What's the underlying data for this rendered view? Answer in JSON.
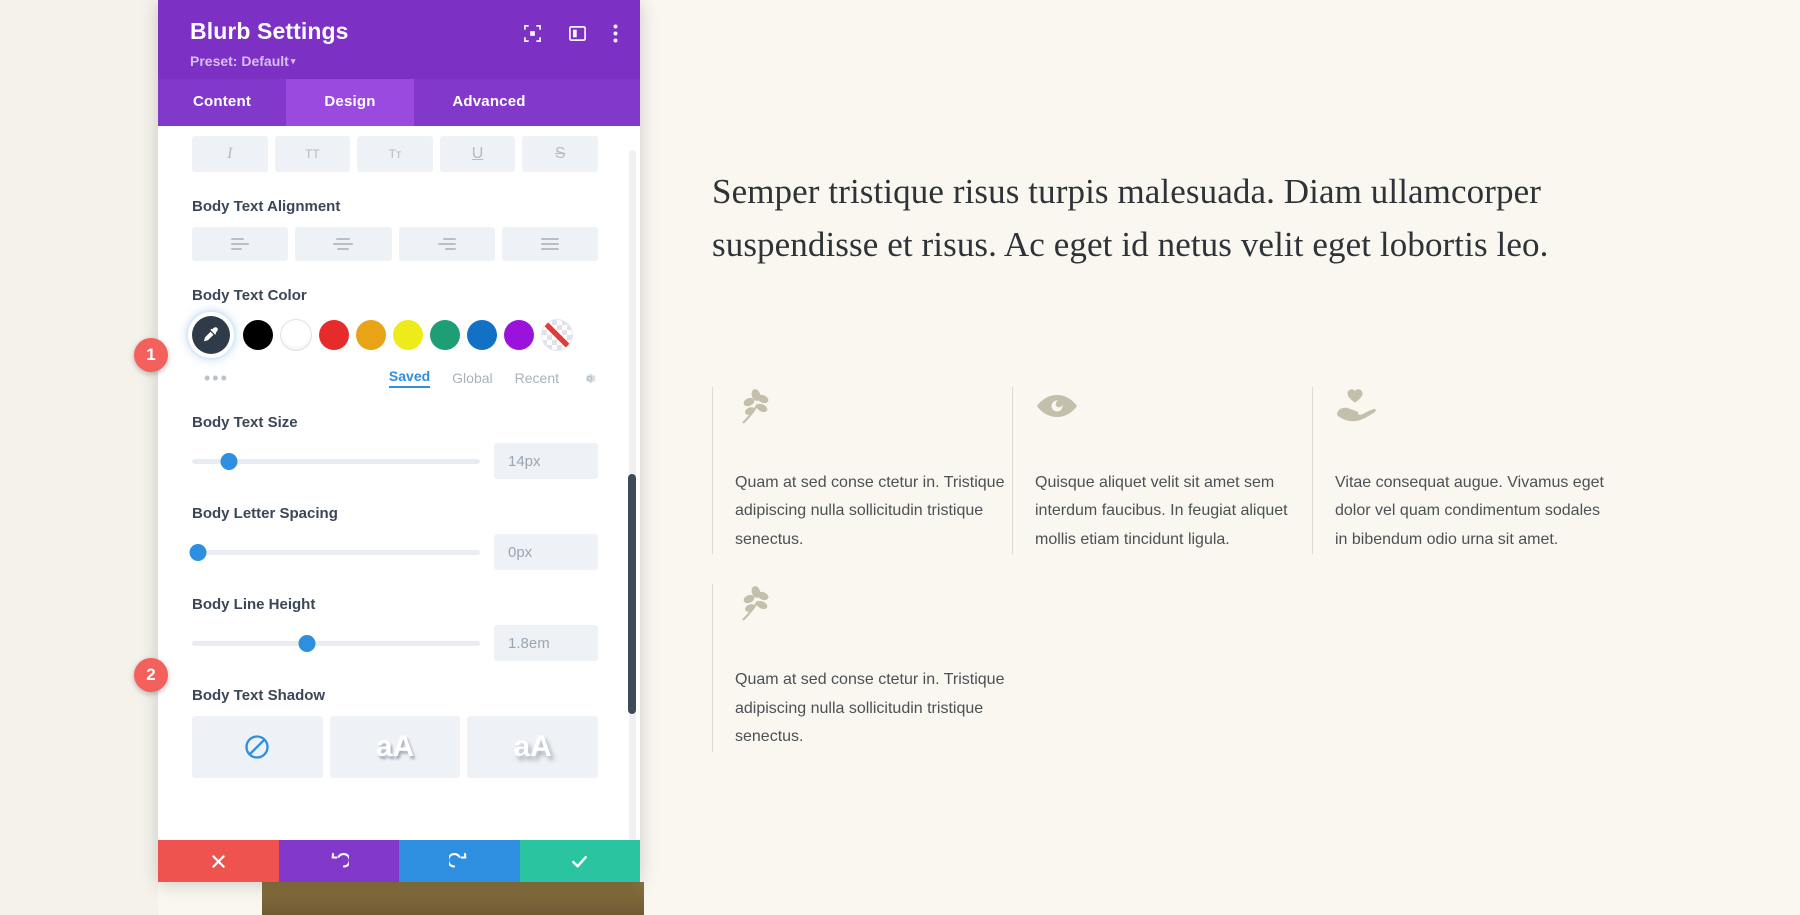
{
  "panel": {
    "title": "Blurb Settings",
    "preset_label": "Preset: Default",
    "header_icons": [
      {
        "name": "focus-icon",
        "label": "focus"
      },
      {
        "name": "layout-panel-icon",
        "label": "layout"
      },
      {
        "name": "more-vertical-icon",
        "label": "more"
      }
    ],
    "tabs": [
      {
        "label": "Content",
        "active": false
      },
      {
        "label": "Design",
        "active": true
      },
      {
        "label": "Advanced",
        "active": false
      }
    ],
    "text_style_buttons": [
      {
        "name": "italic-button",
        "glyph": "I"
      },
      {
        "name": "uppercase-button",
        "glyph": "TT"
      },
      {
        "name": "capitalize-button",
        "glyph": "Tт"
      },
      {
        "name": "underline-button",
        "glyph": "U"
      },
      {
        "name": "strikethrough-button",
        "glyph": "S"
      }
    ],
    "alignment": {
      "label": "Body Text Alignment",
      "options": [
        "align-left",
        "align-center",
        "align-right",
        "align-justify"
      ]
    },
    "color": {
      "label": "Body Text Color",
      "picker_name": "eyedropper-picker",
      "swatches": [
        {
          "name": "swatch-black",
          "hex": "#000000"
        },
        {
          "name": "swatch-white",
          "hex": "#ffffff"
        },
        {
          "name": "swatch-red",
          "hex": "#e62b2b"
        },
        {
          "name": "swatch-orange",
          "hex": "#e8a317"
        },
        {
          "name": "swatch-yellow",
          "hex": "#edeb19"
        },
        {
          "name": "swatch-green",
          "hex": "#1d9e74"
        },
        {
          "name": "swatch-blue",
          "hex": "#1271c4"
        },
        {
          "name": "swatch-purple",
          "hex": "#9c12dd"
        },
        {
          "name": "swatch-none",
          "hex": "transparent"
        }
      ],
      "more_dots": "•••",
      "tabs": [
        {
          "label": "Saved",
          "active": true
        },
        {
          "label": "Global",
          "active": false
        },
        {
          "label": "Recent",
          "active": false
        }
      ],
      "settings_icon": "gear-icon"
    },
    "sliders": [
      {
        "name": "body-text-size",
        "label": "Body Text Size",
        "value": "14px",
        "percent": 13
      },
      {
        "name": "body-letter-spacing",
        "label": "Body Letter Spacing",
        "value": "0px",
        "percent": 2
      },
      {
        "name": "body-line-height",
        "label": "Body Line Height",
        "value": "1.8em",
        "percent": 40
      }
    ],
    "text_shadow": {
      "label": "Body Text Shadow",
      "options": [
        {
          "name": "shadow-none",
          "glyph": "",
          "active": true
        },
        {
          "name": "shadow-soft",
          "glyph": "aA",
          "active": false
        },
        {
          "name": "shadow-strong",
          "glyph": "aA",
          "active": false
        }
      ]
    },
    "actions": [
      {
        "name": "cancel-button",
        "icon": "close-icon"
      },
      {
        "name": "undo-button",
        "icon": "undo-icon"
      },
      {
        "name": "redo-button",
        "icon": "redo-icon"
      },
      {
        "name": "save-button",
        "icon": "check-icon"
      }
    ]
  },
  "step_badges": [
    {
      "name": "step-badge-1",
      "number": "1"
    },
    {
      "name": "step-badge-2",
      "number": "2"
    }
  ],
  "content": {
    "heading": "Semper tristique risus turpis malesuada. Diam ullamcorper suspendisse et risus. Ac eget id netus velit eget lobortis leo.",
    "blurbs": [
      {
        "icon": "leaf-branch-icon",
        "text": "Quam at sed conse ctetur in. Tristique adipiscing nulla sollicitudin tristique senectus."
      },
      {
        "icon": "eye-icon",
        "text": "Quisque aliquet velit sit amet sem interdum faucibus. In feugiat aliquet mollis etiam tincidunt ligula."
      },
      {
        "icon": "heart-in-hand-icon",
        "text": "Vitae consequat augue. Vivamus eget dolor vel quam condimentum sodales in bibendum odio urna sit amet."
      },
      {
        "icon": "leaf-branch-icon",
        "text": "Quam at sed conse ctetur in. Tristique adipiscing nulla sollicitudin tristique senectus."
      }
    ]
  },
  "colors": {
    "panel_header": "#7d30c4",
    "tab_active": "#9b4ae0",
    "accent_blue": "#2e8fe0",
    "badge_red": "#f4605c",
    "save_green": "#2bc4a0",
    "page_bg": "#faf6f0"
  }
}
